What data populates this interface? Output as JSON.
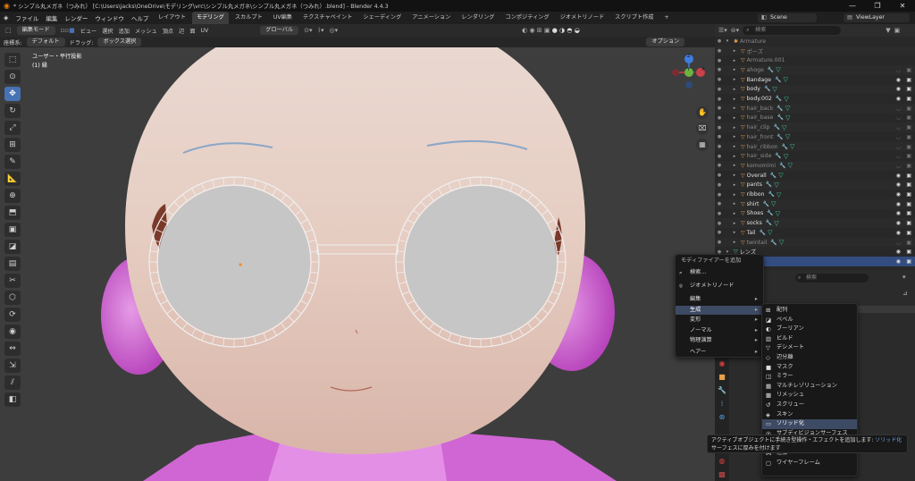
{
  "window": {
    "title": "* シンプル丸メガネ（つみれ） [C:\\Users\\jacks\\OneDrive\\モデリング\\vrc\\シンプル丸メガネ\\シンプル丸メガネ（つみれ）.blend] - Blender 4.4.3",
    "controls": [
      "—",
      "❐",
      "✕"
    ]
  },
  "menubar": {
    "items": [
      "ファイル",
      "編集",
      "レンダー",
      "ウィンドウ",
      "ヘルプ"
    ],
    "workspaces": [
      "レイアウト",
      "モデリング",
      "スカルプト",
      "UV編集",
      "テクスチャペイント",
      "シェーディング",
      "アニメーション",
      "レンダリング",
      "コンポジティング",
      "ジオメトリノード",
      "スクリプト作成",
      "+"
    ],
    "active_workspace": "モデリング",
    "scene": "Scene",
    "view_layer": "ViewLayer"
  },
  "viewport_header": {
    "mode": "編集モード",
    "menus": [
      "ビュー",
      "選択",
      "追加",
      "メッシュ",
      "頂点",
      "辺",
      "面",
      "UV"
    ],
    "orientation": "グローバル",
    "options": "オプション"
  },
  "tool_header": {
    "coord_label": "座標系:",
    "coord_value": "デフォルト",
    "drag_label": "ドラッグ:",
    "drag_value": "ボックス選択"
  },
  "viewport": {
    "view_name": "ユーザー・平行投影",
    "object_label": "(1) 縁",
    "gizmo": {
      "x": "X",
      "y": "Y",
      "z": "Z"
    }
  },
  "toolbar_icons": [
    "select-box-icon",
    "cursor-icon",
    "move-icon",
    "rotate-icon",
    "scale-icon",
    "transform-icon",
    "annotate-icon",
    "measure-icon",
    "add-cube-icon",
    "extrude-icon",
    "inset-icon",
    "bevel-icon",
    "loop-cut-icon",
    "knife-icon",
    "poly-build-icon",
    "spin-icon",
    "smooth-icon",
    "edge-slide-icon",
    "shrink-icon",
    "shear-icon",
    "rip-icon"
  ],
  "toolbar_glyphs": [
    "⬚",
    "⊙",
    "✥",
    "↻",
    "⤢",
    "⊞",
    "✎",
    "📐",
    "⊕",
    "⬒",
    "▣",
    "◪",
    "▤",
    "✂",
    "⬡",
    "⟳",
    "◉",
    "⇔",
    "⇲",
    "⫽",
    "◧"
  ],
  "outliner": {
    "search_placeholder": "検索",
    "items": [
      {
        "name": "Armature",
        "dim": true,
        "indent": 0
      },
      {
        "name": "ポーズ",
        "dim": true,
        "indent": 1
      },
      {
        "name": "Armature.001",
        "dim": true,
        "indent": 1
      },
      {
        "name": "ahoge",
        "dim": true,
        "indent": 1
      },
      {
        "name": "Bandage",
        "dim": false,
        "indent": 1
      },
      {
        "name": "body",
        "dim": false,
        "indent": 1
      },
      {
        "name": "body.002",
        "dim": false,
        "indent": 1
      },
      {
        "name": "hair_back",
        "dim": true,
        "indent": 1
      },
      {
        "name": "hair_base",
        "dim": true,
        "indent": 1
      },
      {
        "name": "hair_clip",
        "dim": true,
        "indent": 1
      },
      {
        "name": "hair_front",
        "dim": true,
        "indent": 1
      },
      {
        "name": "hair_ribbon",
        "dim": true,
        "indent": 1
      },
      {
        "name": "hair_side",
        "dim": true,
        "indent": 1
      },
      {
        "name": "kemomimi",
        "dim": true,
        "indent": 1
      },
      {
        "name": "Overall",
        "dim": false,
        "indent": 1
      },
      {
        "name": "pants",
        "dim": false,
        "indent": 1
      },
      {
        "name": "ribbon",
        "dim": false,
        "indent": 1
      },
      {
        "name": "shirt",
        "dim": false,
        "indent": 1
      },
      {
        "name": "Shoes",
        "dim": false,
        "indent": 1
      },
      {
        "name": "socks",
        "dim": false,
        "indent": 1
      },
      {
        "name": "Tail",
        "dim": false,
        "indent": 1
      },
      {
        "name": "twintail",
        "dim": true,
        "indent": 1
      },
      {
        "name": "レンズ",
        "dim": false,
        "indent": 0
      },
      {
        "name": "縁",
        "dim": false,
        "indent": 0,
        "selected": true
      }
    ]
  },
  "properties": {
    "search_placeholder": "検索"
  },
  "modifier_menu": {
    "title": "モディファイアーを追加",
    "items": [
      {
        "label": "検索...",
        "icon": "⌕"
      },
      {
        "label": "ジオメトリノード",
        "icon": "⌾"
      },
      {
        "label": "編集",
        "arrow": "▸"
      },
      {
        "label": "生成",
        "arrow": "▸",
        "hl": true
      },
      {
        "label": "変形",
        "arrow": "▸"
      },
      {
        "label": "ノーマル",
        "arrow": "▸"
      },
      {
        "label": "物理演算",
        "arrow": "▸"
      },
      {
        "label": "ヘアー",
        "arrow": "▸"
      }
    ]
  },
  "generate_submenu": {
    "items": [
      "配列",
      "ベベル",
      "ブーリアン",
      "ビルド",
      "デシメート",
      "辺分離",
      "マスク",
      "ミラー",
      "マルチレゾリューション",
      "リメッシュ",
      "スクリュー",
      "スキン",
      "ソリッド化",
      "サブディビジョンサーフェス",
      "",
      "溶接",
      "ワイヤーフレーム"
    ],
    "icons": [
      "⊞",
      "◪",
      "◐",
      "▥",
      "▽",
      "◇",
      "■",
      "◫",
      "▦",
      "▩",
      "↺",
      "◈",
      "▭",
      "◎",
      "",
      "⋈",
      "▢"
    ],
    "highlight": "ソリッド化"
  },
  "tooltip": {
    "line1": "アクティブオブジェクトに手続き型操作・エフェクトを追加します:",
    "line1_accent": "ソリッド化",
    "line2": "サーフェスに厚みを付けます"
  },
  "colors": {
    "accent": "#4772b3",
    "selected_row": "#334d80",
    "mesh_green": "#3ec9a0",
    "ear": "#d35fd6",
    "skin": "#e7cdc2",
    "lens": "#c6c6c6"
  }
}
